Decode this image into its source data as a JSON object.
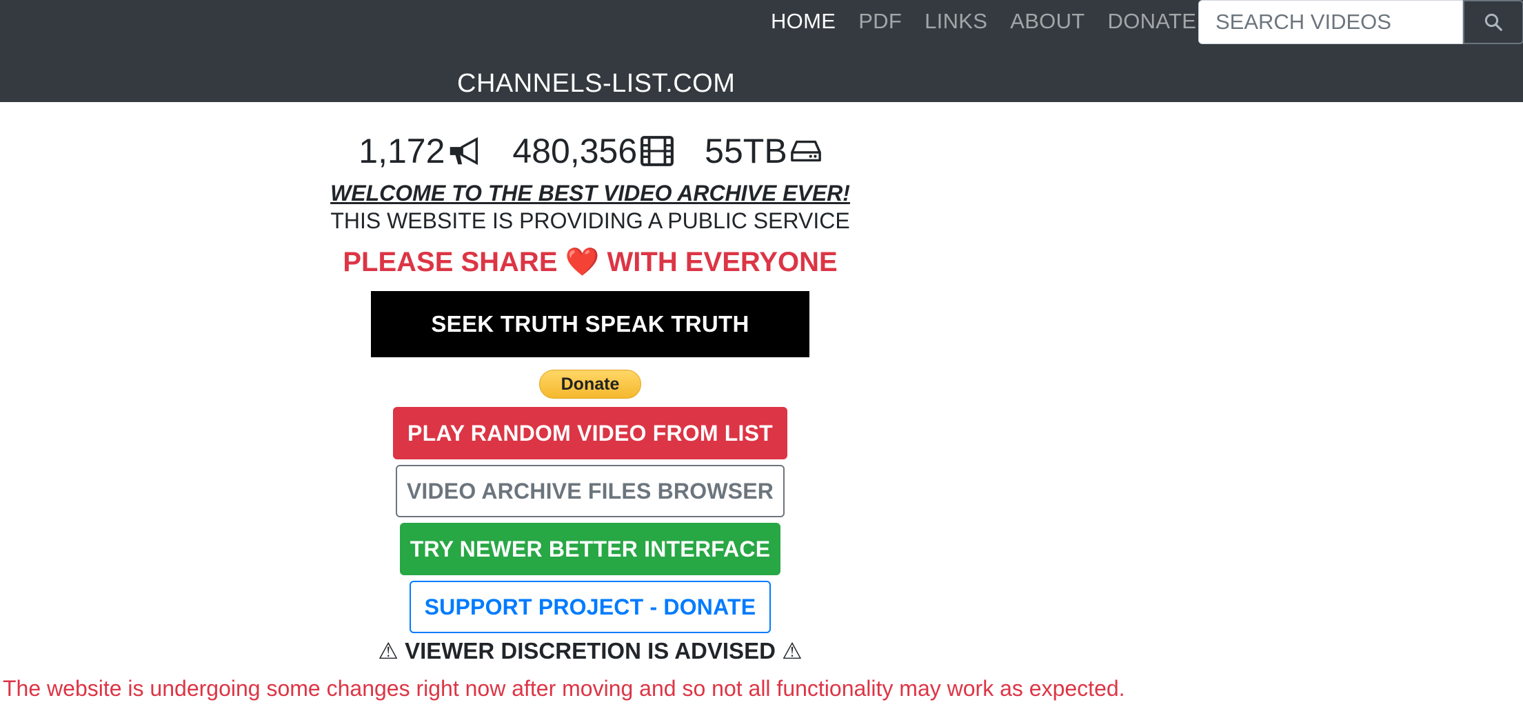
{
  "navbar": {
    "brand": "CHANNELS-LIST.COM",
    "links": [
      {
        "label": "HOME",
        "active": true
      },
      {
        "label": "PDF",
        "active": false
      },
      {
        "label": "LINKS",
        "active": false
      },
      {
        "label": "ABOUT",
        "active": false
      },
      {
        "label": "DONATE",
        "active": false
      }
    ],
    "search": {
      "placeholder": "SEARCH VIDEOS",
      "icon": "search-icon"
    }
  },
  "stats": {
    "channels": {
      "value": "1,172",
      "icon": "megaphone-icon"
    },
    "videos": {
      "value": "480,356",
      "icon": "film-icon"
    },
    "storage": {
      "value": "55TB",
      "icon": "hard-drive-icon"
    }
  },
  "intro": {
    "welcome": "WELCOME TO THE BEST VIDEO ARCHIVE EVER!",
    "public_service": "THIS WEBSITE IS PROVIDING A PUBLIC SERVICE",
    "share_before": "PLEASE SHARE ",
    "share_heart": "❤️",
    "share_after": " WITH EVERYONE"
  },
  "banner": {
    "text": "SEEK TRUTH SPEAK TRUTH"
  },
  "paypal": {
    "label": "Donate"
  },
  "buttons": {
    "random": "PLAY RANDOM VIDEO FROM LIST",
    "browser": "VIDEO ARCHIVE FILES BROWSER",
    "newer": "TRY NEWER BETTER INTERFACE",
    "support": "SUPPORT PROJECT - DONATE"
  },
  "discretion": "⚠ VIEWER DISCRETION IS ADVISED ⚠",
  "notice": "The website is undergoing some changes right now after moving and so not all functionality may work as expected.",
  "colors": {
    "navbar": "#343a40",
    "danger": "#dc3545",
    "success": "#28a745",
    "primary": "#007bff",
    "secondary": "#6c757d"
  }
}
